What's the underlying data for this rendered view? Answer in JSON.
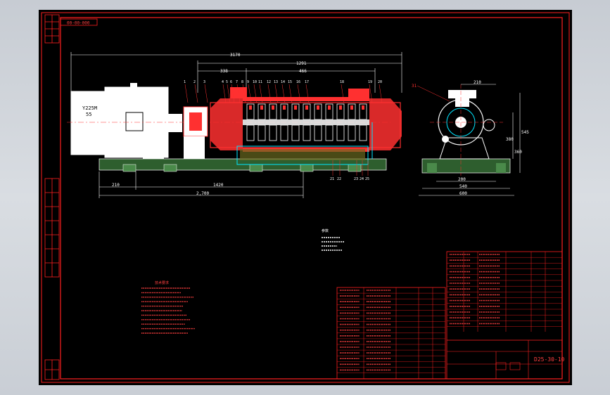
{
  "drawing": {
    "sheet_code_box": "00-00-000",
    "drawing_number": "D25-30-10",
    "motor_label_1": "Y225M",
    "motor_label_2": "55"
  },
  "dimensions": {
    "overall_length": "3170",
    "pump_length": "1291",
    "inner_length": "338",
    "section_length": "466",
    "base_left": "210",
    "base_mid": "1420",
    "base_total": "2,700",
    "side_top": "210",
    "side_base_inner": "200",
    "side_base_width": "540",
    "side_base_total": "600",
    "side_height_1": "380",
    "side_height_2": "360",
    "side_height_3": "545"
  },
  "balloons": {
    "top_row": [
      "1",
      "2",
      "3",
      "4",
      "5",
      "6",
      "7",
      "8",
      "9",
      "10",
      "11",
      "12",
      "13",
      "14",
      "15",
      "16",
      "17",
      "18",
      "19",
      "20"
    ],
    "bottom_row": [
      "21",
      "22",
      "23",
      "24",
      "25"
    ],
    "side_view": "31"
  },
  "parameter_title": "参数",
  "tech_notes_title": "技术要求",
  "colors": {
    "background": "#000000",
    "frame": "#ff2020",
    "dimension": "#ffffff",
    "geometry": "#ffffff",
    "highlight": "#ff3030",
    "cyan": "#00e5ff",
    "base_fill": "#2e5e2e",
    "motor_fill": "#ffffff"
  }
}
